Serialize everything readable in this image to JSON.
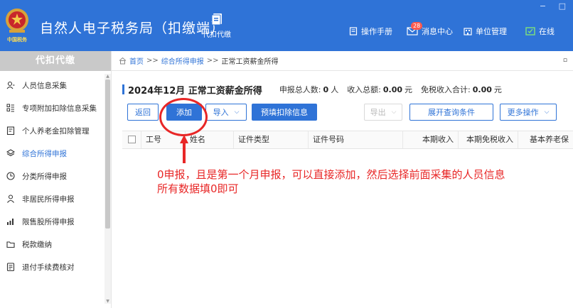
{
  "titlebar": {
    "app_title": "自然人电子税务局（扣缴端）",
    "logo_text": "中国税务",
    "tool": {
      "label": "代扣代缴",
      "icon": "document-stack-icon"
    },
    "menu": [
      {
        "label": "操作手册",
        "icon": "manual-icon"
      },
      {
        "label": "消息中心",
        "icon": "mail-icon",
        "badge": "28"
      },
      {
        "label": "单位管理",
        "icon": "building-icon"
      },
      {
        "label": "在线",
        "icon": "online-check-icon"
      }
    ],
    "window_controls": [
      "−",
      "□"
    ]
  },
  "sidebar": {
    "header": "代扣代缴",
    "active_index": 3,
    "items": [
      {
        "label": "人员信息采集",
        "icon": "person-info-icon"
      },
      {
        "label": "专项附加扣除信息采集",
        "icon": "grid-list-icon"
      },
      {
        "label": "个人养老金扣除管理",
        "icon": "pension-card-icon"
      },
      {
        "label": "综合所得申报",
        "icon": "layers-icon"
      },
      {
        "label": "分类所得申报",
        "icon": "pie-clock-icon"
      },
      {
        "label": "非居民所得申报",
        "icon": "person-outline-icon"
      },
      {
        "label": "限售股所得申报",
        "icon": "bar-chart-icon"
      },
      {
        "label": "税款缴纳",
        "icon": "folder-icon"
      },
      {
        "label": "退付手续费核对",
        "icon": "checklist-icon"
      }
    ]
  },
  "breadcrumb": {
    "items": [
      "首页",
      "综合所得申报",
      "正常工资薪金所得"
    ],
    "separator": ">>",
    "close": "▫"
  },
  "summary": {
    "title": "2024年12月 正常工资薪金所得",
    "people_label": "申报总人数:",
    "people_value": "0",
    "people_unit": "人",
    "income_label": "收入总额:",
    "income_value": "0.00",
    "income_unit": "元",
    "exempt_label": "免税收入合计:",
    "exempt_value": "0.00",
    "exempt_unit": "元"
  },
  "toolbar": {
    "back": "返回",
    "add": "添加",
    "import": "导入",
    "prefill": "预填扣除信息",
    "export": "导出",
    "expand_query": "展开查询条件",
    "more": "更多操作"
  },
  "table": {
    "columns": [
      "工号",
      "姓名",
      "证件类型",
      "证件号码",
      "本期收入",
      "本期免税收入",
      "基本养老保"
    ]
  },
  "annotation": {
    "line1": "0申报，且是第一个月申报，可以直接添加，然后选择前面采集的人员信息",
    "line2": "所有数据填0即可",
    "color": "#e82727"
  },
  "colors": {
    "brand": "#2f73d7",
    "annotation": "#e82727"
  }
}
